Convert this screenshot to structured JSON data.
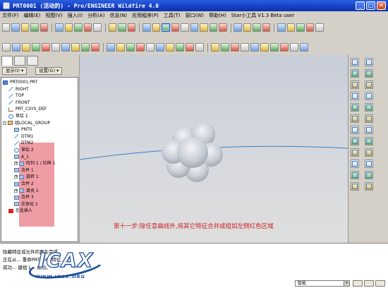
{
  "window": {
    "title": "PRT0001 (活动的) - Pro/ENGINEER Wildfire 4.0",
    "buttons": [
      "_",
      "□",
      "✕"
    ]
  },
  "menu": [
    "文件(F)",
    "编辑(E)",
    "视图(V)",
    "插入(I)",
    "分析(A)",
    "信息(N)",
    "应用程序(P)",
    "工具(T)",
    "窗口(W)",
    "帮助(H)",
    "Star小工具 V1.3 Beta  user"
  ],
  "toolbar": {
    "row1": [
      "new-icon",
      "open-icon",
      "save-icon",
      "print-icon",
      "email-icon",
      "sep",
      "undo-icon",
      "redo-icon",
      "cut-icon",
      "copy-icon",
      "paste-icon",
      "sep",
      "regenerate-icon",
      "find-icon",
      "select-icon",
      "sep",
      "repaint-icon",
      "spin-center-icon",
      "orient-icon",
      "zoom-in-icon",
      "zoom-out-icon",
      "refit-icon",
      "reorient-icon",
      "saved-views-icon",
      "layers-icon",
      "sep",
      "wireframe-icon",
      "hidden-line-icon",
      "no-hidden-icon",
      "shading-icon",
      "sep",
      "datum-plane-icon",
      "datum-axis-icon",
      "datum-point-icon",
      "csys-icon",
      "annotation-icon"
    ],
    "row2": [
      "feature-icon-1",
      "feature-icon-2",
      "feature-icon-3",
      "feature-icon-4",
      "feature-icon-5",
      "feature-icon-6",
      "feature-icon-7",
      "feature-icon-8",
      "feature-icon-9",
      "feature-icon-10",
      "sep",
      "feature-icon-11",
      "feature-icon-12",
      "feature-icon-13",
      "feature-icon-14",
      "feature-icon-15",
      "feature-icon-16",
      "feature-icon-17",
      "feature-icon-18",
      "feature-icon-19",
      "feature-icon-20",
      "sep",
      "feature-icon-21",
      "feature-icon-22",
      "feature-icon-23",
      "feature-icon-24",
      "feature-icon-25",
      "feature-icon-26",
      "feature-icon-27",
      "feature-icon-28",
      "feature-icon-29",
      "feature-icon-30"
    ]
  },
  "navigator": {
    "show_label": "显示(I) ▾",
    "settings_label": "设置(G) ▾"
  },
  "tree": [
    {
      "label": "PRT0001.PRT",
      "icon": "part",
      "indent": 0,
      "expander": ""
    },
    {
      "label": "RIGHT",
      "icon": "datum",
      "indent": 1,
      "expander": ""
    },
    {
      "label": "TOP",
      "icon": "datum",
      "indent": 1,
      "expander": ""
    },
    {
      "label": "FRONT",
      "icon": "datum",
      "indent": 1,
      "expander": ""
    },
    {
      "label": "PRT_CSYS_DEF",
      "icon": "csys",
      "indent": 1,
      "expander": ""
    },
    {
      "label": "草绘 1",
      "icon": "sketch",
      "indent": 1,
      "expander": ""
    },
    {
      "label": "组LOCAL_GROUP",
      "icon": "group",
      "indent": 0,
      "expander": "-"
    },
    {
      "label": "PNT0",
      "icon": "feat",
      "indent": 2,
      "expander": ""
    },
    {
      "label": "DTM1",
      "icon": "datum",
      "indent": 2,
      "expander": ""
    },
    {
      "label": "DTM2",
      "icon": "datum",
      "indent": 2,
      "expander": ""
    },
    {
      "label": "草绘 2",
      "icon": "sketch",
      "indent": 2,
      "expander": ""
    },
    {
      "label": "A_1",
      "icon": "feat",
      "indent": 2,
      "expander": ""
    },
    {
      "label": "阵列 1 / 拉伸 1",
      "icon": "feat",
      "indent": 2,
      "expander": "+"
    },
    {
      "label": "合并 1",
      "icon": "feat",
      "indent": 2,
      "expander": ""
    },
    {
      "label": "旋转 1",
      "icon": "feat",
      "indent": 2,
      "expander": "+"
    },
    {
      "label": "合并 2",
      "icon": "feat",
      "indent": 2,
      "expander": ""
    },
    {
      "label": "填充 1",
      "icon": "feat",
      "indent": 2,
      "expander": "+"
    },
    {
      "label": "合并 3",
      "icon": "feat",
      "indent": 2,
      "expander": ""
    },
    {
      "label": "实体化 1",
      "icon": "feat",
      "indent": 2,
      "expander": ""
    },
    {
      "label": "在此插入",
      "icon": "insert",
      "indent": 1,
      "expander": ""
    }
  ],
  "viewport": {
    "caption": "第十一步:除任意曲线外,将其它特征合并成组如左侧红色区域",
    "background_top": "#c8cdd8",
    "shape_color": "#c9ced6",
    "curve_color": "#3a7fc6",
    "highlight_color": "#e65a69"
  },
  "messages": [
    "隐藏特征或元件的再生完成。",
    "正在从... 重命PRT0001特征...",
    "成功... 建组 L... 成功。"
  ],
  "status": {
    "filter_label": "智能"
  },
  "watermark": {
    "word": "ICAX",
    "url": "WWW.ICAX.ORG"
  }
}
